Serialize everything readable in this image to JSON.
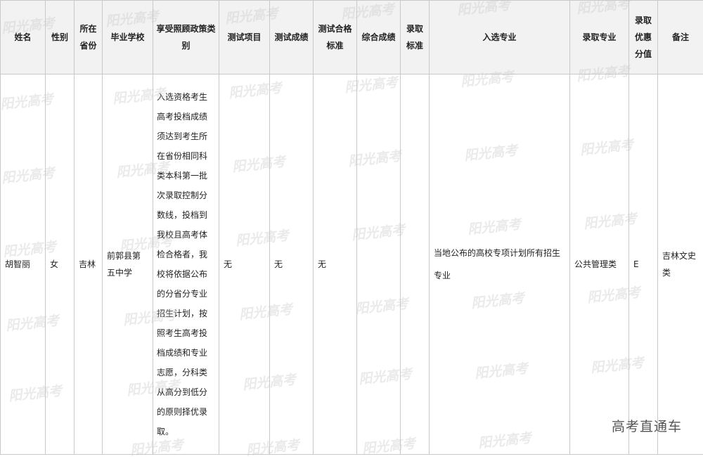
{
  "headers": {
    "name": "姓名",
    "gender": "性别",
    "province": "所在省份",
    "school": "毕业学校",
    "policy": "享受照顾政策类别",
    "test_item": "测试项目",
    "test_score": "测试成绩",
    "test_standard": "测试合格标准",
    "total_score": "综合成绩",
    "admit_standard": "录取标准",
    "selected_major": "入选专业",
    "admit_major": "录取专业",
    "bonus": "录取优惠分值",
    "remark": "备注"
  },
  "row": {
    "name": "胡智丽",
    "gender": "女",
    "province": "吉林",
    "school": "前郭县第五中学",
    "policy": "入选资格考生高考投档成绩须达到考生所在省份相同科类本科第一批次录取控制分数线，投档到我校且高考体检合格者，我校将依据公布的分省分专业招生计划，按照考生高考投档成绩和专业志愿，分科类从高分到低分的原则择优录取。",
    "test_item": "无",
    "test_score": "无",
    "test_standard": "无",
    "total_score": "",
    "admit_standard": "",
    "selected_major": "当地公布的高校专项计划所有招生专业",
    "admit_major": "公共管理类",
    "bonus": "E",
    "remark": "吉林文史类"
  },
  "watermark": "阳光高考",
  "footer": "高考直通车"
}
